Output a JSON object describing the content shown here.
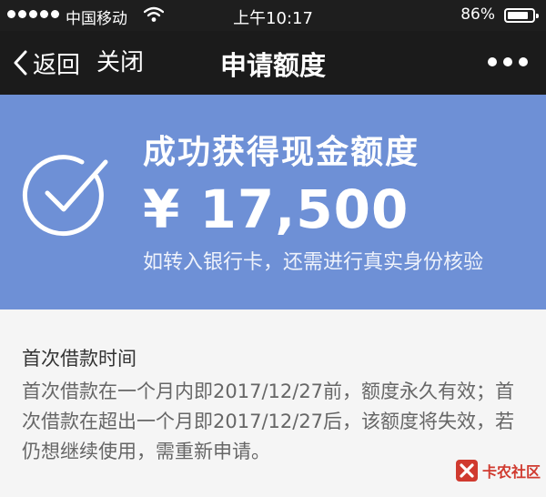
{
  "status_bar": {
    "carrier": "中国移动",
    "time": "上午10:17",
    "battery": "86%",
    "battery_level": 0.86
  },
  "nav": {
    "back_label": "返回",
    "close_label": "关闭",
    "title": "申请额度"
  },
  "banner": {
    "headline": "成功获得现金额度",
    "amount": "¥ 17,500",
    "note": "如转入银行卡，还需进行真实身份核验",
    "background_color": "#6e90d6"
  },
  "content": {
    "section_title": "首次借款时间",
    "section_body": "首次借款在一个月内即2017/12/27前，额度永久有效；首次借款在超出一个月即2017/12/27后，该额度将失效，若仍想继续使用，需重新申请。"
  },
  "watermark": {
    "text": "卡农社区"
  }
}
